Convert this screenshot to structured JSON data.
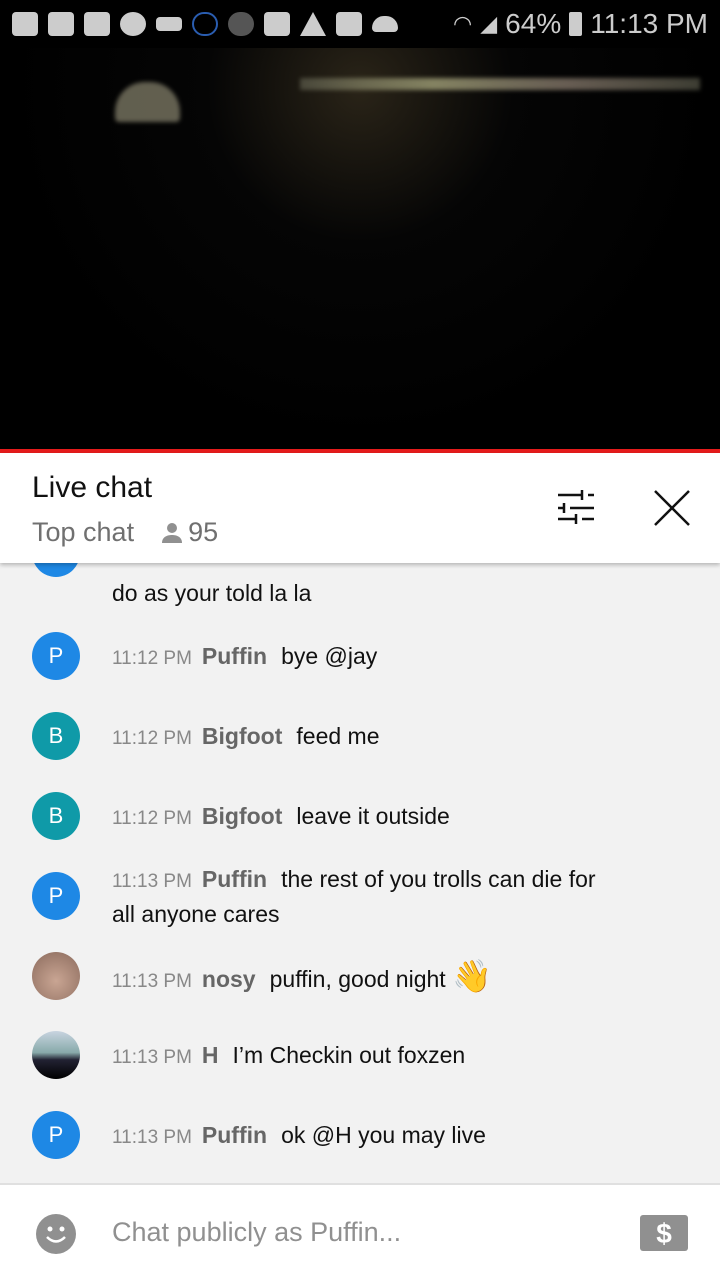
{
  "status_bar": {
    "icons": [
      "message-icon",
      "youtube-icon",
      "youtube-icon",
      "m-app-icon",
      "crown-icon",
      "cloud-outline-icon",
      "m-app-icon",
      "folder-icon",
      "warning-icon",
      "image-icon",
      "cloud-icon"
    ],
    "battery": "64%",
    "time": "11:13 PM"
  },
  "header": {
    "title": "Live chat",
    "mode": "Top chat",
    "viewers": "95"
  },
  "colors": {
    "accent_red": "#e51b1b",
    "avatar_blue": "#1e88e5",
    "avatar_teal": "#0f9aa8"
  },
  "messages": [
    {
      "text": "do as your told la la",
      "partial": true
    },
    {
      "avatar": "P",
      "time": "11:12 PM",
      "author": "Puffin",
      "text": "bye @jay"
    },
    {
      "avatar": "B",
      "time": "11:12 PM",
      "author": "Bigfoot",
      "text": "feed me"
    },
    {
      "avatar": "B",
      "time": "11:12 PM",
      "author": "Bigfoot",
      "text": "leave it outside"
    },
    {
      "avatar": "P",
      "time": "11:13 PM",
      "author": "Puffin",
      "text": "the rest of you trolls can die for all anyone cares"
    },
    {
      "avatar": "",
      "time": "11:13 PM",
      "author": "nosy",
      "text": "puffin, good night",
      "emoji": "👋"
    },
    {
      "avatar": "",
      "time": "11:13 PM",
      "author": "H",
      "text": "I’m Checkin out foxzen"
    },
    {
      "avatar": "P",
      "time": "11:13 PM",
      "author": "Puffin",
      "text": "ok @H you may live"
    }
  ],
  "input": {
    "placeholder": "Chat publicly as Puffin..."
  }
}
